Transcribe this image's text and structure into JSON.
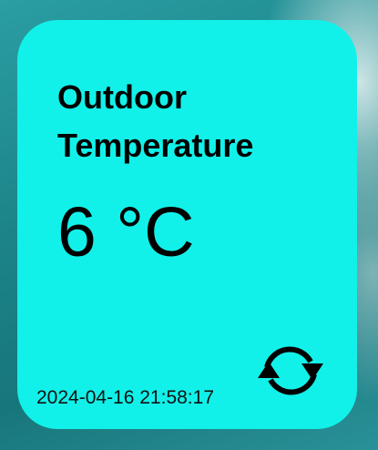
{
  "widget": {
    "title": "Outdoor\nTemperature",
    "temperature": "6 °C",
    "timestamp": "2024-04-16 21:58:17",
    "refresh_icon": "refresh-icon"
  },
  "colors": {
    "card_background": "#12f1e9",
    "text": "#000000"
  }
}
